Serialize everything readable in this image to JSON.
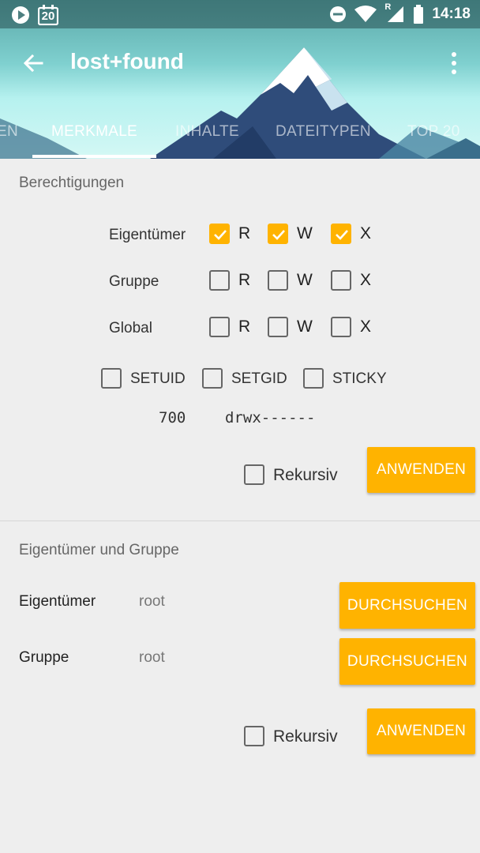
{
  "status_bar": {
    "calendar_day": "20",
    "roaming_indicator": "R",
    "time": "14:18",
    "icons": [
      "play-icon",
      "calendar-icon",
      "do-not-disturb-icon",
      "wifi-icon",
      "cell-signal-icon",
      "battery-icon"
    ]
  },
  "toolbar": {
    "title": "lost+found",
    "back_icon": "arrow-left-icon",
    "menu_icon": "more-vert-icon"
  },
  "tabs": [
    {
      "label": "EN",
      "active": false
    },
    {
      "label": "MERKMALE",
      "active": true
    },
    {
      "label": "INHALTE",
      "active": false
    },
    {
      "label": "DATEITYPEN",
      "active": false
    },
    {
      "label": "TOP 20",
      "active": false
    }
  ],
  "permissions": {
    "title": "Berechtigungen",
    "rows": [
      {
        "label": "Eigentümer",
        "r": true,
        "w": true,
        "x": true
      },
      {
        "label": "Gruppe",
        "r": false,
        "w": false,
        "x": false
      },
      {
        "label": "Global",
        "r": false,
        "w": false,
        "x": false
      }
    ],
    "letters": {
      "r": "R",
      "w": "W",
      "x": "X"
    },
    "special": [
      {
        "label": "SETUID",
        "checked": false
      },
      {
        "label": "SETGID",
        "checked": false
      },
      {
        "label": "STICKY",
        "checked": false
      }
    ],
    "octal": "700",
    "symbolic": "drwx------",
    "recursive_label": "Rekursiv",
    "recursive_checked": false,
    "apply_label": "ANWENDEN"
  },
  "ownership": {
    "title": "Eigentümer und Gruppe",
    "owner_label": "Eigentümer",
    "owner_value": "root",
    "group_label": "Gruppe",
    "group_value": "root",
    "browse_label": "DURCHSUCHEN",
    "recursive_label": "Rekursiv",
    "recursive_checked": false,
    "apply_label": "ANWENDEN"
  },
  "colors": {
    "accent": "#ffb300",
    "header_teal": "#7fd0cf"
  }
}
